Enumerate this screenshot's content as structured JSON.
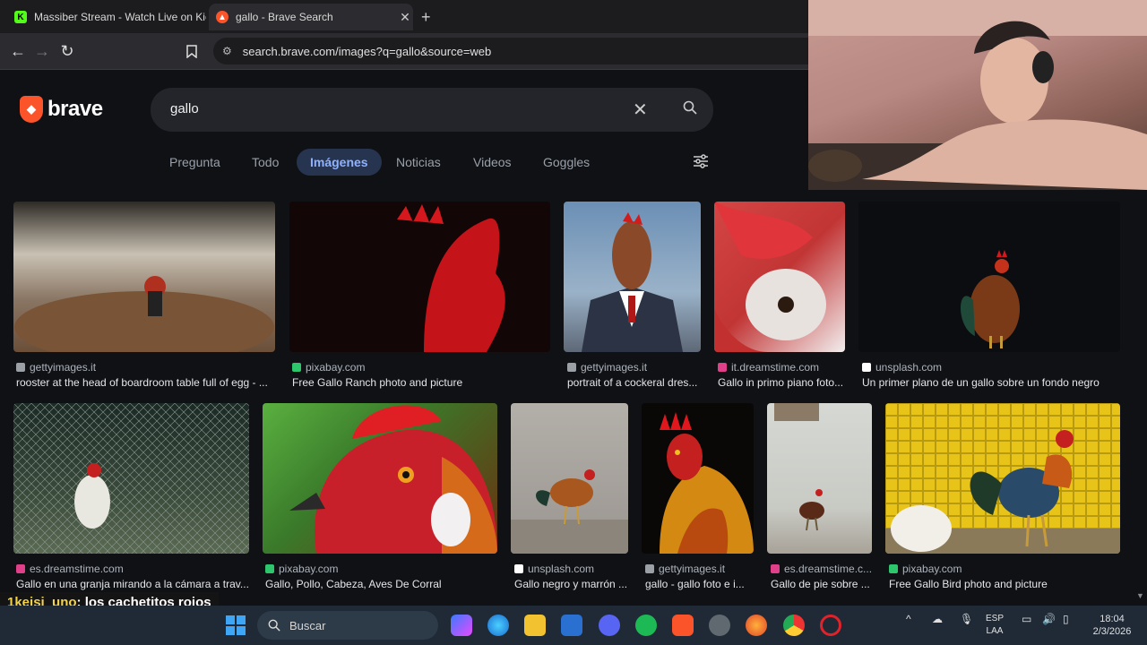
{
  "browser": {
    "tabs": [
      {
        "title": "Massiber Stream - Watch Live on Kick",
        "favicon": "kick-icon",
        "active": false
      },
      {
        "title": "gallo - Brave Search",
        "favicon": "brave-icon",
        "active": true
      }
    ],
    "url": "search.brave.com/images?q=gallo&source=web"
  },
  "search": {
    "brand": "brave",
    "query": "gallo",
    "tabs": [
      {
        "label": "Pregunta"
      },
      {
        "label": "Todo"
      },
      {
        "label": "Imágenes",
        "active": true
      },
      {
        "label": "Noticias"
      },
      {
        "label": "Videos"
      },
      {
        "label": "Goggles"
      }
    ]
  },
  "results": [
    {
      "source": "gettyimages.it",
      "caption": "rooster at the head of boardroom table full of egg - ...",
      "icon_color": "#9aa0a6"
    },
    {
      "source": "pixabay.com",
      "caption": "Free Gallo Ranch photo and picture",
      "icon_color": "#2ec66d"
    },
    {
      "source": "gettyimages.it",
      "caption": "portrait of a cockeral dres...",
      "icon_color": "#9aa0a6"
    },
    {
      "source": "it.dreamstime.com",
      "caption": "Gallo in primo piano foto...",
      "icon_color": "#e0408a"
    },
    {
      "source": "unsplash.com",
      "caption": "Un primer plano de un gallo sobre un fondo negro",
      "icon_color": "#ffffff"
    },
    {
      "source": "es.dreamstime.com",
      "caption": "Gallo en una granja mirando a la cámara a trav...",
      "icon_color": "#e0408a"
    },
    {
      "source": "pixabay.com",
      "caption": "Gallo, Pollo, Cabeza, Aves De Corral",
      "icon_color": "#2ec66d"
    },
    {
      "source": "unsplash.com",
      "caption": "Gallo negro y marrón ...",
      "icon_color": "#ffffff"
    },
    {
      "source": "gettyimages.it",
      "caption": "gallo - gallo foto e i...",
      "icon_color": "#9aa0a6"
    },
    {
      "source": "es.dreamstime.c...",
      "caption": "Gallo de pie sobre ...",
      "icon_color": "#e0408a"
    },
    {
      "source": "pixabay.com",
      "caption": "Free Gallo Bird photo and picture",
      "icon_color": "#2ec66d"
    }
  ],
  "chat": {
    "user": "1keisi_uno",
    "message": ": los cachetitos rojos"
  },
  "taskbar": {
    "search_placeholder": "Buscar",
    "lang_top": "ESP",
    "lang_bottom": "LAA",
    "time": "18:04",
    "date": "2/3/2026"
  },
  "colors": {
    "accent": "#8fb2ff",
    "brave_orange": "#fb542b"
  }
}
